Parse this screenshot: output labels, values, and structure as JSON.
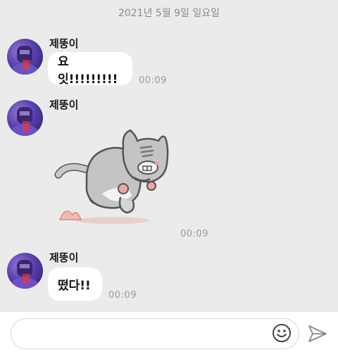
{
  "date_header": "2021년 5월 9일 일요일",
  "messages": [
    {
      "sender": "제뚱이",
      "text": "요잇!!!!!!!!!",
      "time": "00:09"
    },
    {
      "sender": "제뚱이",
      "type": "sticker",
      "sticker": "running-cat-sticker",
      "time": "00:09"
    },
    {
      "sender": "제뚱이",
      "text": "떴다!!",
      "time": "00:09"
    }
  ],
  "input": {
    "placeholder": ""
  },
  "icons": {
    "emoji": "smiley-icon",
    "send": "paper-plane-icon"
  }
}
